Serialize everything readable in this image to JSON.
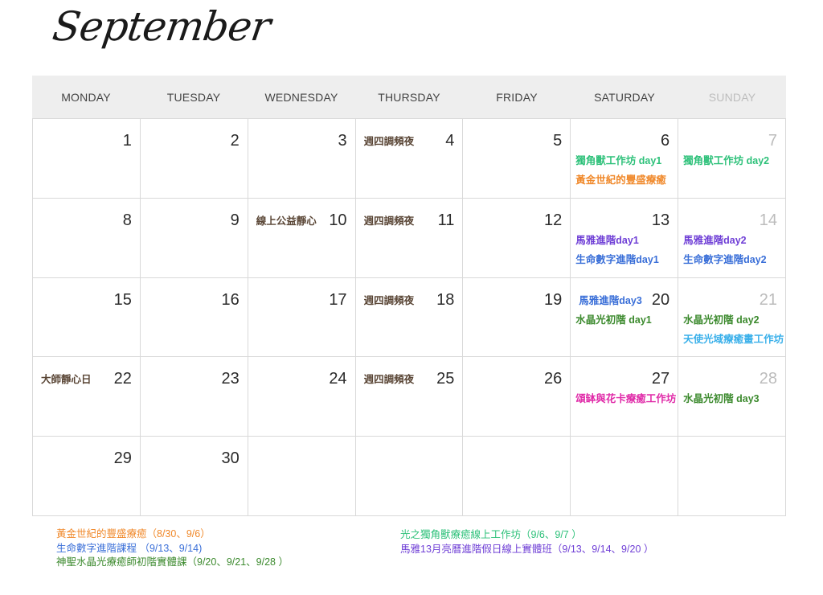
{
  "month": "September",
  "weekdays": [
    "MONDAY",
    "TUESDAY",
    "WEDNESDAY",
    "THURSDAY",
    "FRIDAY",
    "SATURDAY",
    "SUNDAY"
  ],
  "colors": {
    "orange": "#f0892b",
    "blue": "#3a6fd8",
    "green": "#3c8a2e",
    "mint": "#2ec17a",
    "purple": "#6f3fd6",
    "brown": "#5a4636",
    "pink": "#e02aa8",
    "sky": "#3ab0ea",
    "grid": "#d9d9d9",
    "header_bg": "#eeeeee"
  },
  "weeks": [
    [
      {
        "day": "1",
        "events": []
      },
      {
        "day": "2",
        "events": []
      },
      {
        "day": "3",
        "events": []
      },
      {
        "day": "4",
        "events": [
          {
            "text": "週四調頻夜",
            "color": "brown",
            "pos": "left"
          }
        ]
      },
      {
        "day": "5",
        "events": []
      },
      {
        "day": "6",
        "events": [
          {
            "text": "獨角獸工作坊 day1",
            "color": "mint",
            "pos": "l1"
          },
          {
            "text": "黃金世紀的豐盛療癒",
            "color": "orange",
            "pos": "l2"
          }
        ]
      },
      {
        "day": "7",
        "events": [
          {
            "text": "獨角獸工作坊 day2",
            "color": "mint",
            "pos": "l1"
          }
        ]
      }
    ],
    [
      {
        "day": "8",
        "events": []
      },
      {
        "day": "9",
        "events": []
      },
      {
        "day": "10",
        "events": [
          {
            "text": "線上公益靜心",
            "color": "brown",
            "pos": "left"
          }
        ]
      },
      {
        "day": "11",
        "events": [
          {
            "text": "週四調頻夜",
            "color": "brown",
            "pos": "left"
          }
        ]
      },
      {
        "day": "12",
        "events": []
      },
      {
        "day": "13",
        "events": [
          {
            "text": "馬雅進階day1",
            "color": "purple",
            "pos": "l1"
          },
          {
            "text": "生命數字進階day1",
            "color": "blue",
            "pos": "l2"
          }
        ]
      },
      {
        "day": "14",
        "events": [
          {
            "text": "馬雅進階day2",
            "color": "purple",
            "pos": "l1"
          },
          {
            "text": "生命數字進階day2",
            "color": "blue",
            "pos": "l2"
          }
        ]
      }
    ],
    [
      {
        "day": "15",
        "events": []
      },
      {
        "day": "16",
        "events": []
      },
      {
        "day": "17",
        "events": []
      },
      {
        "day": "18",
        "events": [
          {
            "text": "週四調頻夜",
            "color": "brown",
            "pos": "left"
          }
        ]
      },
      {
        "day": "19",
        "events": []
      },
      {
        "day": "20",
        "events": [
          {
            "text": "馬雅進階day3",
            "color": "blue",
            "pos": "left"
          },
          {
            "text": "水晶光初階 day1",
            "color": "green",
            "pos": "l1"
          }
        ]
      },
      {
        "day": "21",
        "events": [
          {
            "text": "水晶光初階 day2",
            "color": "green",
            "pos": "l1"
          },
          {
            "text": "天使光域療癒畫工作坊",
            "color": "sky",
            "pos": "l2"
          }
        ]
      }
    ],
    [
      {
        "day": "22",
        "events": [
          {
            "text": "大師靜心日",
            "color": "brown",
            "pos": "left"
          }
        ]
      },
      {
        "day": "23",
        "events": []
      },
      {
        "day": "24",
        "events": []
      },
      {
        "day": "25",
        "events": [
          {
            "text": "週四調頻夜",
            "color": "brown",
            "pos": "left"
          }
        ]
      },
      {
        "day": "26",
        "events": []
      },
      {
        "day": "27",
        "events": [
          {
            "text": "頌缽與花卡療癒工作坊",
            "color": "pink",
            "pos": "l1"
          }
        ]
      },
      {
        "day": "28",
        "events": [
          {
            "text": "水晶光初階 day3",
            "color": "green",
            "pos": "l1"
          }
        ]
      }
    ],
    [
      {
        "day": "29",
        "events": []
      },
      {
        "day": "30",
        "events": []
      },
      {
        "day": "",
        "events": []
      },
      {
        "day": "",
        "events": []
      },
      {
        "day": "",
        "events": []
      },
      {
        "day": "",
        "events": []
      },
      {
        "day": "",
        "events": []
      }
    ]
  ],
  "legend": {
    "left": [
      {
        "text": "黃金世紀的豐盛療癒（8/30、9/6）",
        "color": "orange"
      },
      {
        "text": "生命數字進階課程 （9/13、9/14)",
        "color": "blue"
      },
      {
        "text": "神聖水晶光療癒師初階實體課（9/20、9/21、9/28 ）",
        "color": "green"
      }
    ],
    "right": [
      {
        "text": "光之獨角獸療癒線上工作坊（9/6、9/7 ）",
        "color": "mint"
      },
      {
        "text": "馬雅13月亮曆進階假日線上實體班（9/13、9/14、9/20 ）",
        "color": "purple"
      }
    ]
  }
}
